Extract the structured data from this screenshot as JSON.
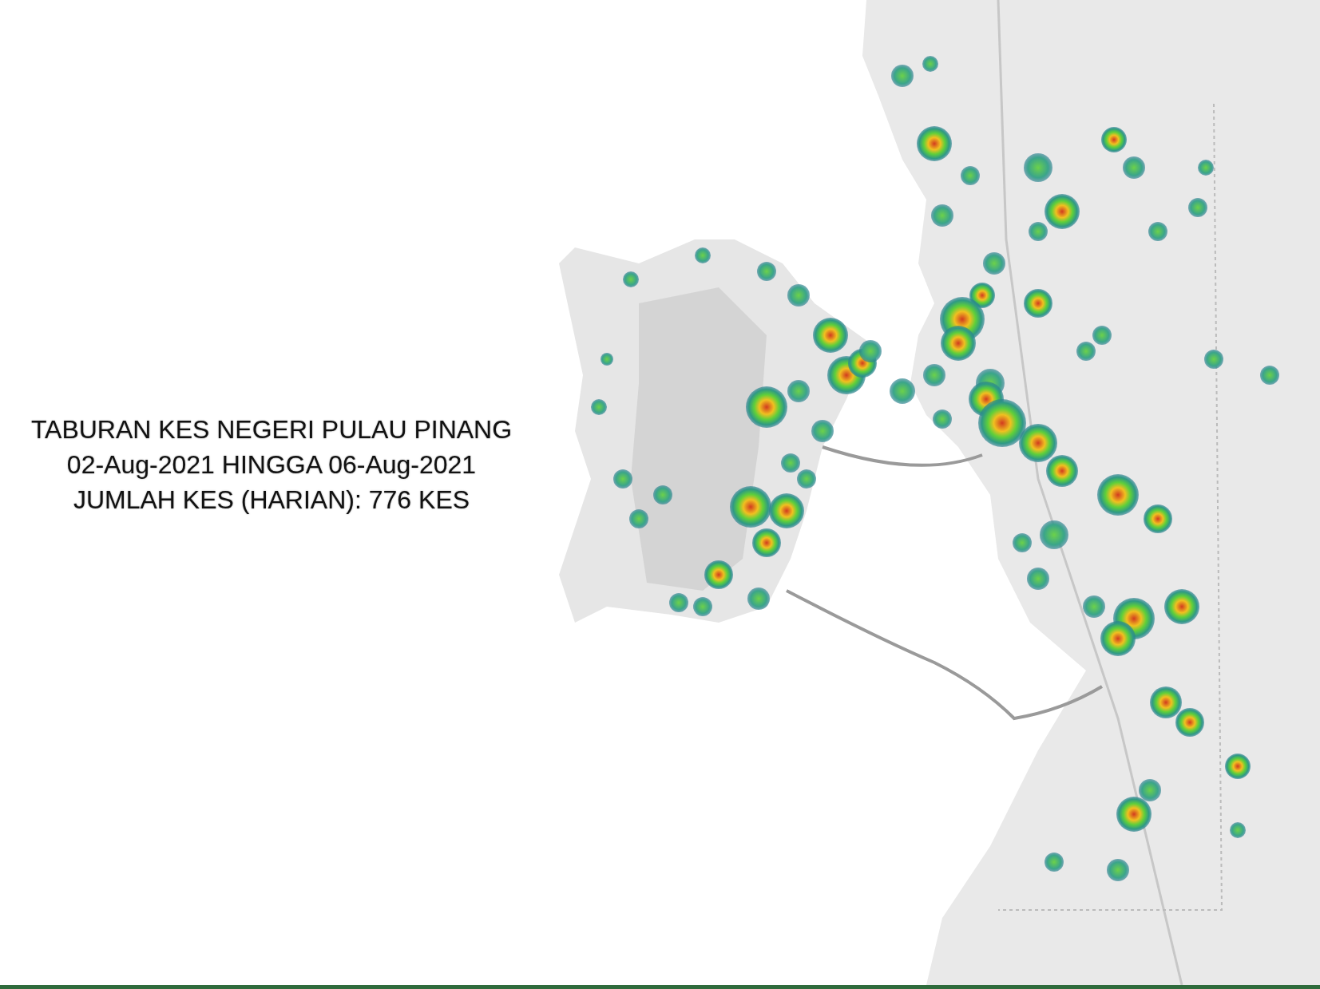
{
  "title_lines": [
    "TABURAN KES NEGERI PULAU PINANG",
    "02-Aug-2021 HINGGA 06-Aug-2021",
    "JUMLAH KES (HARIAN): 776 KES"
  ]
}
